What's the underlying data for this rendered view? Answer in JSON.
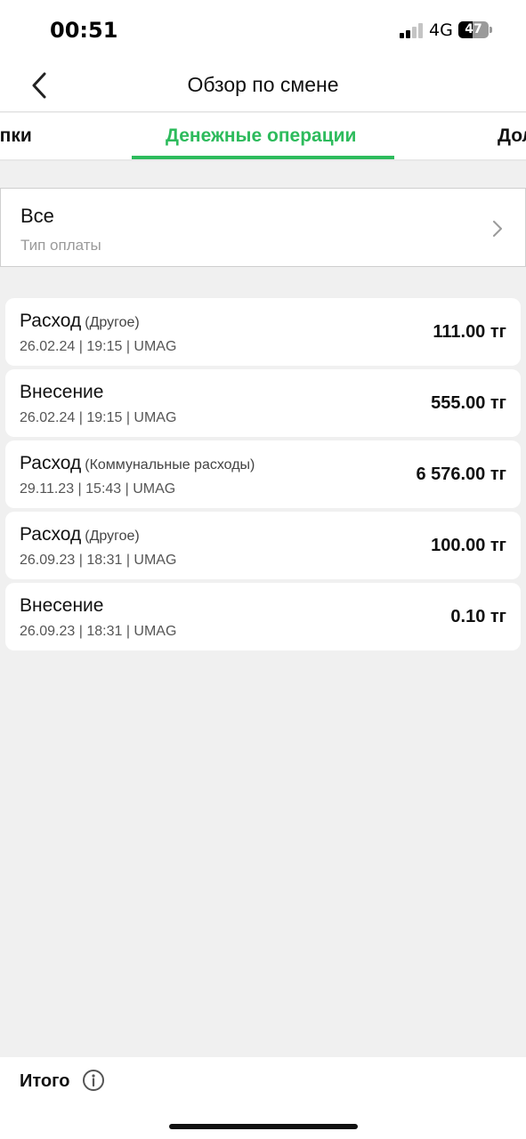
{
  "status_bar": {
    "time": "00:51",
    "network": "4G",
    "battery_percent": "47",
    "battery_level": 0.47,
    "signal_bars_active": 2,
    "signal_bars_total": 4
  },
  "nav": {
    "title": "Обзор по смене",
    "back_icon": "chevron-left-icon"
  },
  "tabs": [
    {
      "label": "упки",
      "active": false
    },
    {
      "label": "Денежные операции",
      "active": true
    },
    {
      "label": "Дол",
      "active": false
    }
  ],
  "filter": {
    "value": "Все",
    "label": "Тип оплаты",
    "icon": "chevron-right-icon"
  },
  "operations": [
    {
      "type": "Расход",
      "category": "(Другое)",
      "meta": "26.02.24 | 19:15 | UMAG",
      "amount": "111.00 тг"
    },
    {
      "type": "Внесение",
      "category": "",
      "meta": "26.02.24 | 19:15 | UMAG",
      "amount": "555.00 тг"
    },
    {
      "type": "Расход",
      "category": "(Коммунальные расходы)",
      "meta": "29.11.23 | 15:43 | UMAG",
      "amount": "6 576.00 тг"
    },
    {
      "type": "Расход",
      "category": "(Другое)",
      "meta": "26.09.23 | 18:31 | UMAG",
      "amount": "100.00 тг"
    },
    {
      "type": "Внесение",
      "category": "",
      "meta": "26.09.23 | 18:31 | UMAG",
      "amount": "0.10 тг"
    }
  ],
  "footer": {
    "total_label": "Итого",
    "info_icon": "info-icon"
  },
  "colors": {
    "accent": "#2dbb5c",
    "background": "#f0f0f0",
    "card": "#ffffff"
  }
}
